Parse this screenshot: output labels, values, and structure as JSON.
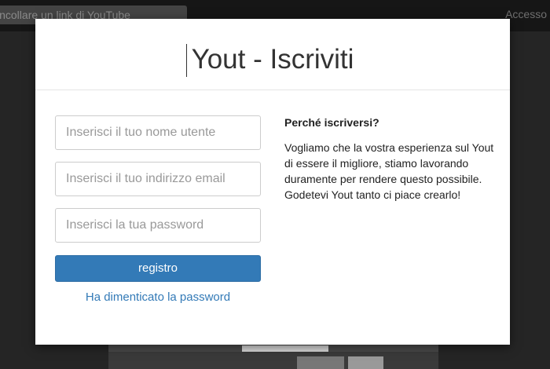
{
  "background": {
    "search_text": "incollare un link di YouTube",
    "login_text": "Accesso"
  },
  "modal": {
    "title": "Yout - Iscriviti",
    "username_placeholder": "Inserisci il tuo nome utente",
    "email_placeholder": "Inserisci il tuo indirizzo email",
    "password_placeholder": "Inserisci la tua password",
    "register_label": "registro",
    "forgot_label": "Ha dimenticato la password",
    "why_title": "Perché iscriversi?",
    "why_text": "Vogliamo che la vostra esperienza sul Yout di essere il migliore, stiamo lavorando duramente per rendere questo possibile. Godetevi Yout tanto ci piace crearlo!"
  },
  "colors": {
    "primary": "#337ab7",
    "overlay": "#1c1c1c"
  }
}
